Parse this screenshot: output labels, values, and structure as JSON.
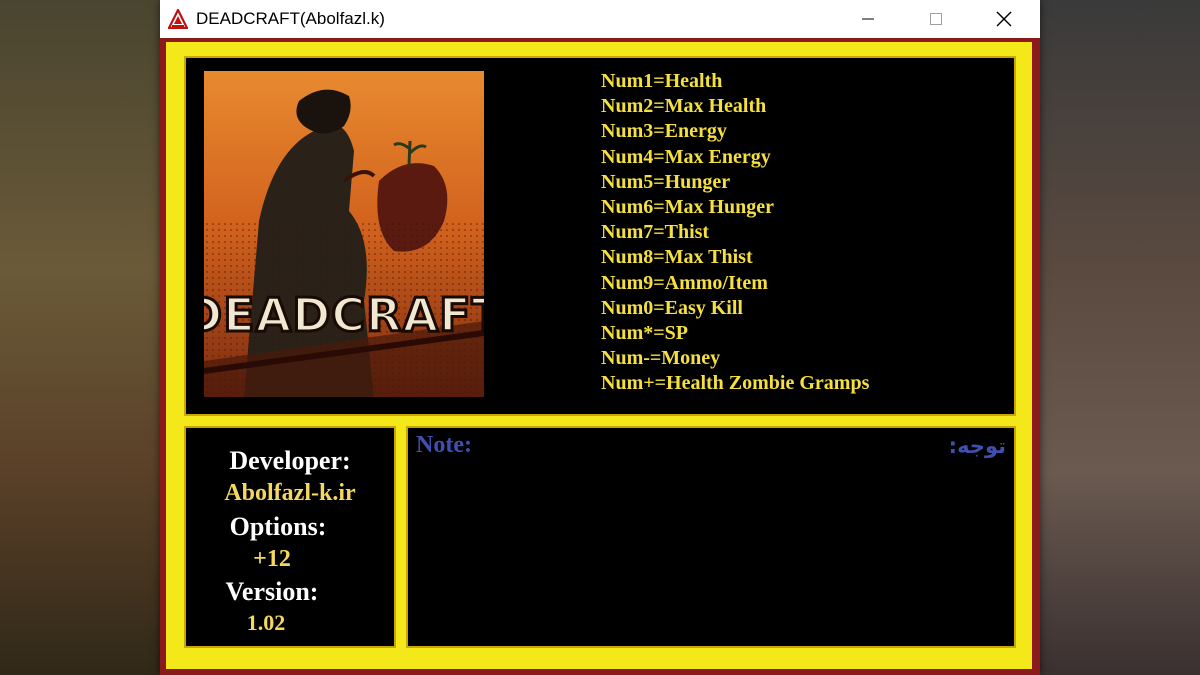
{
  "window": {
    "title": "DEADCRAFT(Abolfazl.k)",
    "buttons": [
      "minimize",
      "maximize",
      "close"
    ]
  },
  "cover": {
    "logo_text": "DEADCRAFT"
  },
  "hotkeys": [
    "Num1=Health",
    "Num2=Max Health",
    "Num3=Energy",
    "Num4=Max Energy",
    "Num5=Hunger",
    "Num6=Max Hunger",
    "Num7=Thist",
    "Num8=Max Thist",
    "Num9=Ammo/Item",
    "Num0=Easy Kill",
    "Num*=SP",
    "Num-=Money",
    "Num+=Health Zombie Gramps"
  ],
  "info": {
    "developer_label": "Developer:",
    "developer_value": "Abolfazl-k.ir",
    "options_label": "Options:",
    "options_value": "+12",
    "version_label": "Version:",
    "version_value": "1.02"
  },
  "note": {
    "label": "Note:",
    "label_fa": "توجه:",
    "text": ""
  },
  "colors": {
    "frame_red": "#8b1a1a",
    "frame_yellow": "#f5e81a",
    "hotkey_text": "#f5e040",
    "note_label": "#4050b0"
  }
}
